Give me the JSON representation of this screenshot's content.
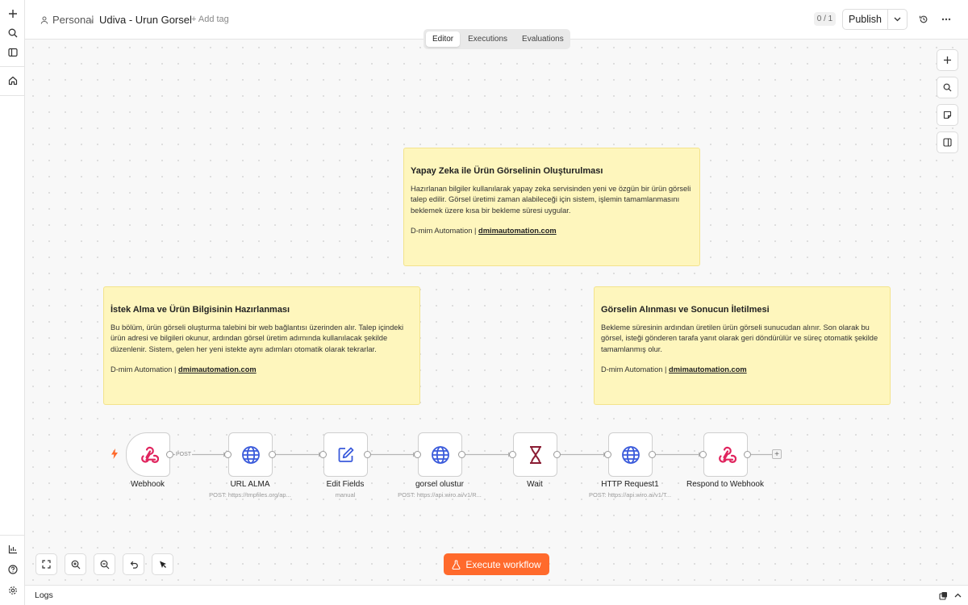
{
  "rail": {
    "top_items": [
      "plus-icon",
      "search-icon",
      "sidebar-icon",
      "home-icon"
    ],
    "bottom_items": [
      "insights-icon",
      "help-icon",
      "settings-icon"
    ]
  },
  "header": {
    "breadcrumb_project": "Personal",
    "breadcrumb_sep": "/",
    "workflow_title": "Udiva - Urun Gorsel",
    "add_tag": "+ Add tag",
    "counter": "0 / 1",
    "publish_label": "Publish"
  },
  "tabs": [
    {
      "label": "Editor",
      "active": true
    },
    {
      "label": "Executions",
      "active": false
    },
    {
      "label": "Evaluations",
      "active": false
    }
  ],
  "notes": {
    "center": {
      "title": "Yapay Zeka ile Ürün Görselinin Oluşturulması",
      "body": "Hazırlanan bilgiler kullanılarak yapay zeka servisinden yeni ve özgün bir ürün görseli talep edilir. Görsel üretimi zaman alabileceği için sistem, işlemin tamamlanmasını beklemek üzere kısa bir bekleme süresi uygular.",
      "sig_prefix": "D-mim Automation | ",
      "sig_link": "dmimautomation.com"
    },
    "left": {
      "title": "İstek Alma ve Ürün Bilgisinin Hazırlanması",
      "body": "Bu bölüm, ürün görseli oluşturma talebini bir web bağlantısı üzerinden alır. Talep içindeki ürün adresi ve bilgileri okunur, ardından görsel üretim adımında kullanılacak şekilde düzenlenir. Sistem, gelen her yeni istekte aynı adımları otomatik olarak tekrarlar.",
      "sig_prefix": "D-mim Automation | ",
      "sig_link": "dmimautomation.com"
    },
    "right": {
      "title": "Görselin Alınması ve Sonucun İletilmesi",
      "body": "Bekleme süresinin ardından üretilen ürün görseli sunucudan alınır. Son olarak bu görsel, isteği gönderen tarafa yanıt olarak geri döndürülür ve süreç otomatik şekilde tamamlanmış olur.",
      "sig_prefix": "D-mim Automation | ",
      "sig_link": "dmimautomation.com"
    }
  },
  "workflow": {
    "post_label": "POST",
    "nodes": [
      {
        "name": "Webhook",
        "sub": "",
        "icon": "webhook-icon",
        "color": "#e0245e"
      },
      {
        "name": "URL ALMA",
        "sub": "POST: https://tmpfiles.org/ap...",
        "icon": "globe-icon",
        "color": "#3b5bdb"
      },
      {
        "name": "Edit Fields",
        "sub": "manual",
        "icon": "pencil-icon",
        "color": "#3b5bdb"
      },
      {
        "name": "gorsel olustur",
        "sub": "POST: https://api.wiro.ai/v1/R...",
        "icon": "globe-icon",
        "color": "#3b5bdb"
      },
      {
        "name": "Wait",
        "sub": "",
        "icon": "hourglass-icon",
        "color": "#8a1c33"
      },
      {
        "name": "HTTP Request1",
        "sub": "POST: https://api.wiro.ai/v1/T...",
        "icon": "globe-icon",
        "color": "#3b5bdb"
      },
      {
        "name": "Respond to Webhook",
        "sub": "",
        "icon": "webhook-icon",
        "color": "#e0245e"
      }
    ]
  },
  "canvas_controls": [
    "fit-view-icon",
    "zoom-in-icon",
    "zoom-out-icon",
    "undo-icon",
    "cursor-icon"
  ],
  "execute_label": "Execute workflow",
  "logs_label": "Logs",
  "colors": {
    "accent": "#ff6a2c",
    "note_bg": "#fef6bd",
    "trigger_bolt": "#ff6a2c"
  }
}
